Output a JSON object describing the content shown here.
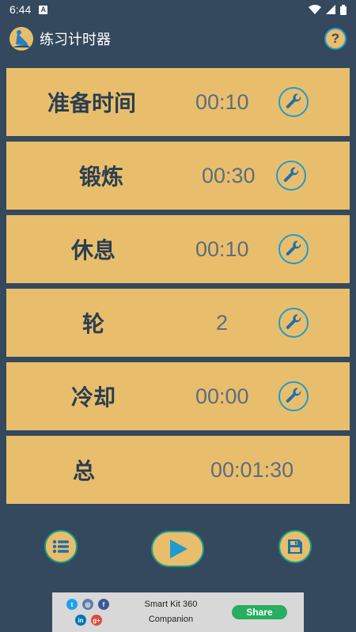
{
  "status_bar": {
    "time": "6:44",
    "notification_letter": "A"
  },
  "app_bar": {
    "title": "练习计时器",
    "help_label": "?"
  },
  "rows": [
    {
      "label": "准备时间",
      "value": "00:10",
      "has_settings": true
    },
    {
      "label": "锻炼",
      "value": "00:30",
      "has_settings": true
    },
    {
      "label": "休息",
      "value": "00:10",
      "has_settings": true
    },
    {
      "label": "轮",
      "value": "2",
      "has_settings": true
    },
    {
      "label": "冷却",
      "value": "00:00",
      "has_settings": true
    },
    {
      "label": "总",
      "value": "00:01:30",
      "has_settings": false
    }
  ],
  "bottom_bar": {
    "icons": [
      "list-icon",
      "play-icon",
      "save-icon"
    ]
  },
  "ad": {
    "line1": "Smart Kit 360",
    "line2": "Companion",
    "share_label": "Share",
    "social": {
      "twitter": "t",
      "instagram": "◎",
      "facebook": "f",
      "linkedin": "in",
      "google_plus": "g+"
    }
  },
  "colors": {
    "background": "#34495e",
    "card": "#e8be6c",
    "label_text": "#2c3e50",
    "value_text": "#5d6d7e",
    "accent_blue": "#1f9bd1",
    "accent_green": "#16a085"
  }
}
